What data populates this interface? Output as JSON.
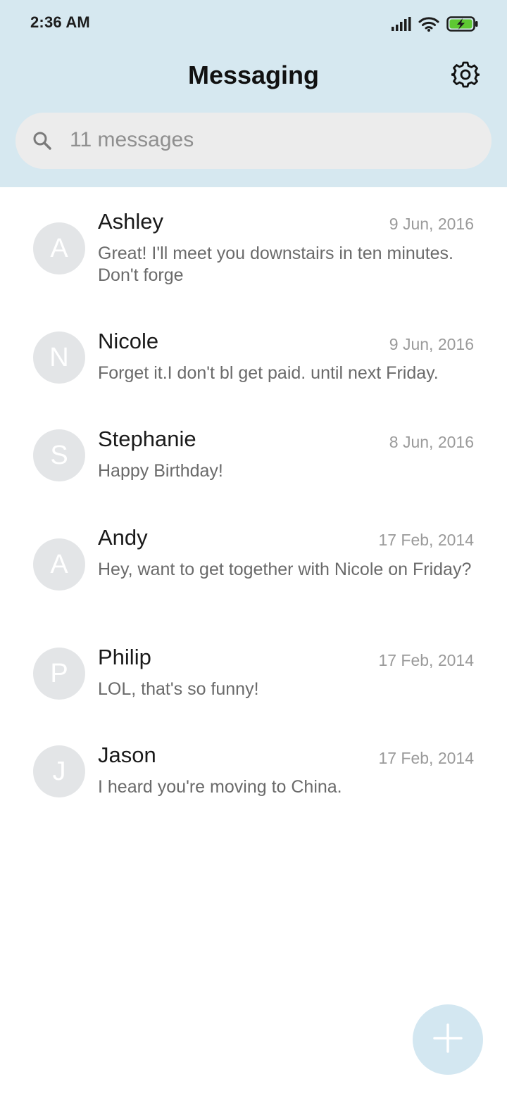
{
  "status_bar": {
    "time": "2:36 AM",
    "icons": [
      "signal-icon",
      "wifi-icon",
      "battery-charging-icon"
    ],
    "battery_color": "#5ec832"
  },
  "header": {
    "title": "Messaging",
    "settings_icon": "gear-icon"
  },
  "search": {
    "icon": "search-icon",
    "text": "11 messages"
  },
  "conversations": [
    {
      "initial": "A",
      "name": "Ashley",
      "date": "9 Jun, 2016",
      "snippet": "Great! I'll meet you downstairs in ten minutes. Don't forge"
    },
    {
      "initial": "N",
      "name": "Nicole",
      "date": "9 Jun, 2016",
      "snippet": "Forget it.I don't bl get paid. until next Friday."
    },
    {
      "initial": "S",
      "name": "Stephanie",
      "date": "8 Jun, 2016",
      "snippet": "Happy Birthday!"
    },
    {
      "initial": "A",
      "name": "Andy",
      "date": "17 Feb, 2014",
      "snippet": "Hey, want to get together with Nicole on Friday?"
    },
    {
      "initial": "P",
      "name": "Philip",
      "date": "17 Feb, 2014",
      "snippet": "LOL, that's so funny!"
    },
    {
      "initial": "J",
      "name": "Jason",
      "date": "17 Feb, 2014",
      "snippet": "I heard you're moving to China."
    }
  ],
  "fab": {
    "icon": "plus-icon"
  },
  "colors": {
    "header_bg": "#d6e8f0",
    "search_bg": "#ececec",
    "avatar_bg": "#e3e5e7",
    "fab_bg": "#d3e7f1"
  }
}
